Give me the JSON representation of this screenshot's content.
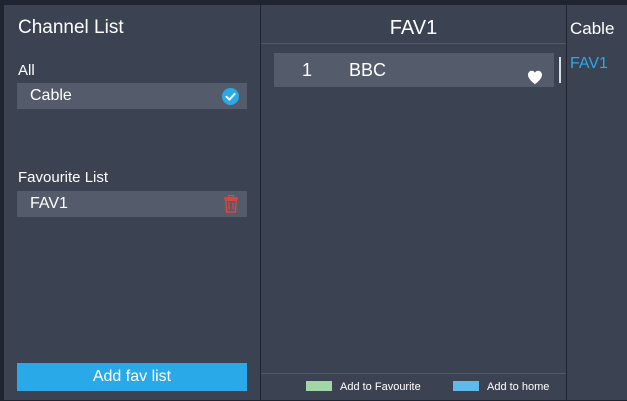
{
  "channel_list": {
    "title": "Channel List",
    "all_label": "All",
    "sources": [
      {
        "label": "Cable",
        "selected": true
      }
    ],
    "favourite_label": "Favourite List",
    "favourites": [
      {
        "label": "FAV1"
      }
    ],
    "add_button": "Add fav list"
  },
  "fav_panel": {
    "title": "FAV1",
    "channels": [
      {
        "number": "1",
        "name": "BBC",
        "favourite": true
      }
    ],
    "legend": [
      {
        "label": "Add to Favourite",
        "color": "#a2d6a6"
      },
      {
        "label": "Add to home",
        "color": "#5fb9ec"
      }
    ]
  },
  "right_panel": {
    "items": [
      "Cable",
      "FAV1"
    ]
  },
  "colors": {
    "accent": "#2aa9e8",
    "panel": "#3b4353",
    "row": "#545c6c",
    "delete": "#e0453f"
  }
}
